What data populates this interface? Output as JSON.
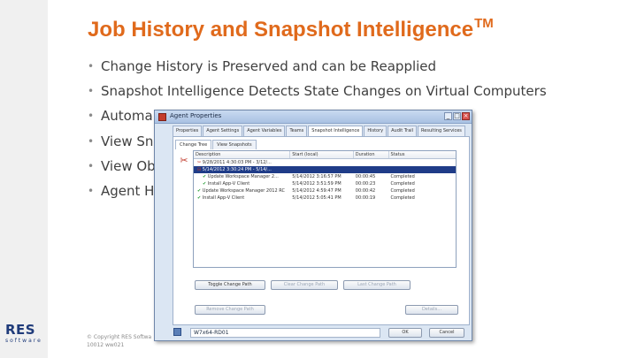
{
  "slide": {
    "title": "Job History and Snapshot Intelligence",
    "title_tm": "TM",
    "bullets": [
      "Change History is Preserved and can be Reapplied",
      "Snapshot Intelligence Detects State Changes on Virtual Computers",
      "Automa",
      "View Sn",
      "View Ob",
      "Agent H"
    ],
    "copyright_line1": "© Copyright RES Softwa",
    "copyright_line2": "10012 ww021",
    "brand_logo": "RES",
    "brand_sub": "software",
    "title_color": "#e06a1c"
  },
  "dialog": {
    "title": "Agent Properties",
    "tabs": [
      "Properties",
      "Agent Settings",
      "Agent Variables",
      "Teams",
      "Snapshot Intelligence",
      "History",
      "Audit Trail",
      "Resulting Services"
    ],
    "active_tab": "Snapshot Intelligence",
    "subtabs": [
      "Change Tree",
      "View Snapshots"
    ],
    "columns": [
      "Description",
      "Start (local)",
      "Duration",
      "Status"
    ],
    "rows": [
      {
        "level": 0,
        "marker": "✂",
        "description": "9/28/2011 4:30:03 PM - 3/12/...",
        "start": "",
        "duration": "",
        "status": "",
        "selected": false
      },
      {
        "level": 0,
        "marker": "⊟",
        "description": "5/14/2012 3:30:24 PM - 5/14/...",
        "start": "",
        "duration": "",
        "status": "",
        "selected": true
      },
      {
        "level": 1,
        "marker": "✔",
        "description": "Update Workspace Manager 2...",
        "start": "5/14/2012 3:16:57 PM",
        "duration": "00:00:45",
        "status": "Completed",
        "selected": false
      },
      {
        "level": 1,
        "marker": "✔",
        "description": "Install App-V Client",
        "start": "5/14/2012 3:51:59 PM",
        "duration": "00:00:23",
        "status": "Completed",
        "selected": false
      },
      {
        "level": 0,
        "marker": "✔",
        "description": "Update Workspace Manager 2012 RC",
        "start": "5/14/2012 4:59:47 PM",
        "duration": "00:00:42",
        "status": "Completed",
        "selected": false
      },
      {
        "level": 0,
        "marker": "✔",
        "description": "Install App-V Client",
        "start": "5/14/2012 5:05:41 PM",
        "duration": "00:00:19",
        "status": "Completed",
        "selected": false
      }
    ],
    "buttons": {
      "toggle": "Toggle Change Path",
      "clear": "Clear Change Path",
      "last": "Last Change Path",
      "remove": "Remove Change Path",
      "details": "Details...",
      "ok": "OK",
      "cancel": "Cancel"
    },
    "agent_name": "W7x64-RD01"
  }
}
